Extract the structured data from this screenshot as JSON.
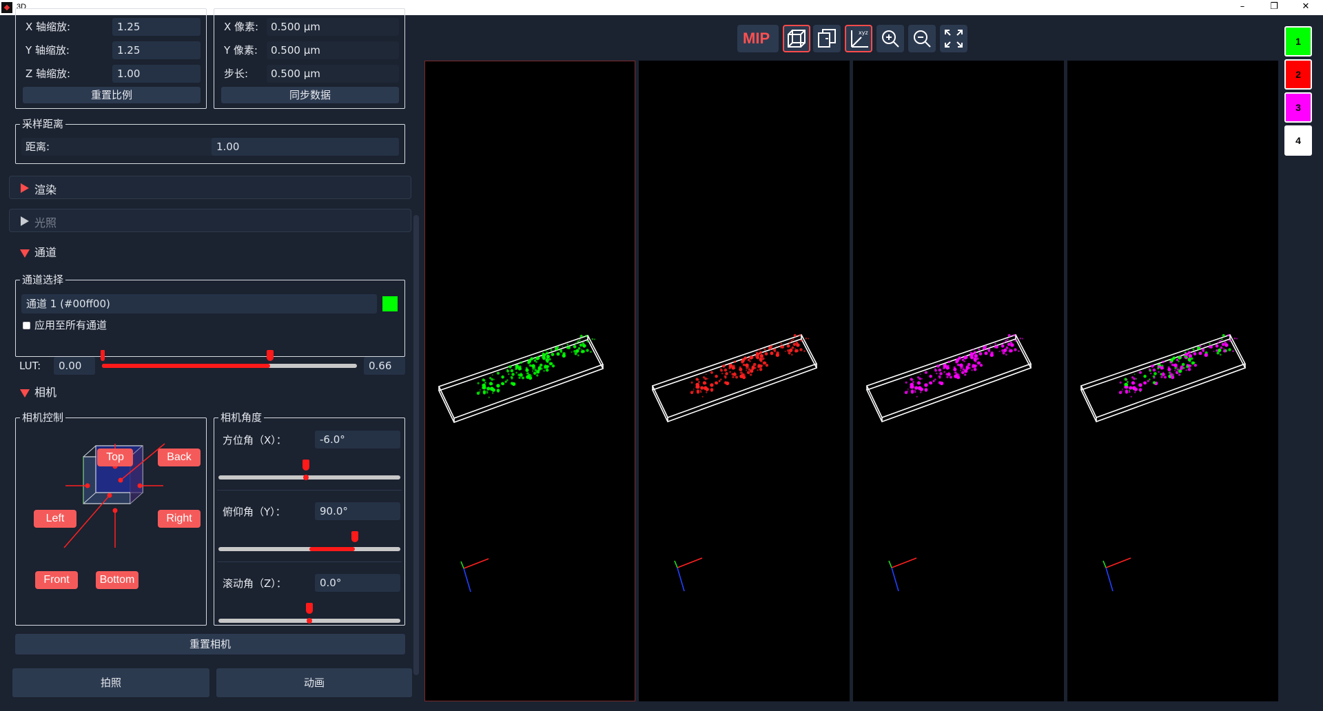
{
  "window": {
    "title": "3D",
    "minimize": "–",
    "maximize": "❐",
    "close": "✕"
  },
  "scale": {
    "x_label": "X 轴缩放:",
    "x_value": "1.25",
    "y_label": "Y 轴缩放:",
    "y_value": "1.25",
    "z_label": "Z 轴缩放:",
    "z_value": "1.00",
    "reset_button": "重置比例"
  },
  "pixel": {
    "x_label": "X 像素:",
    "x_value": "0.500 µm",
    "y_label": "Y 像素:",
    "y_value": "0.500 µm",
    "step_label": "步长:",
    "step_value": "0.500 µm",
    "sync_button": "同步数据"
  },
  "sampling": {
    "title": "采样距离",
    "label": "距离:",
    "value": "1.00"
  },
  "sections": {
    "render": "渲染",
    "lighting": "光照",
    "channel": "通道",
    "camera": "相机"
  },
  "channel": {
    "group_title": "通道选择",
    "selected": "通道 1 (#00ff00)",
    "selected_color": "#00ff00",
    "apply_all": "应用至所有通道",
    "apply_all_checked": false,
    "lut_label": "LUT:",
    "lut_min": "0.00",
    "lut_max": "0.66",
    "lut_range_fraction": [
      0.0,
      0.66
    ]
  },
  "camera": {
    "control_title": "相机控制",
    "angle_title": "相机角度",
    "views": {
      "top": "Top",
      "back": "Back",
      "left": "Left",
      "right": "Right",
      "front": "Front",
      "bottom": "Bottom"
    },
    "azimuth_label": "方位角（X）：",
    "azimuth_value": "-6.0°",
    "azimuth_fraction": 0.48,
    "pitch_label": "俯仰角（Y）：",
    "pitch_value": "90.0°",
    "pitch_fraction": 0.75,
    "roll_label": "滚动角（Z）：",
    "roll_value": "0.0°",
    "roll_fraction": 0.5,
    "reset_button": "重置相机"
  },
  "bottom": {
    "snapshot": "拍照",
    "animation": "动画"
  },
  "toolbar": {
    "mip": "MIP",
    "items": [
      "mip",
      "bounding-box",
      "clip",
      "axes",
      "zoom-in",
      "zoom-out",
      "fullscreen"
    ],
    "axes_text": "xyz"
  },
  "viewports": [
    {
      "channel": "1",
      "color": "#00ff00"
    },
    {
      "channel": "2",
      "color": "#ff2020"
    },
    {
      "channel": "3",
      "color": "#ff00ff"
    },
    {
      "channel": "4",
      "color": "#ffffff"
    }
  ],
  "channels": [
    {
      "label": "1",
      "color": "#00ff00"
    },
    {
      "label": "2",
      "color": "#ff0000"
    },
    {
      "label": "3",
      "color": "#ff00ff"
    },
    {
      "label": "4",
      "color": "#ffffff"
    }
  ]
}
